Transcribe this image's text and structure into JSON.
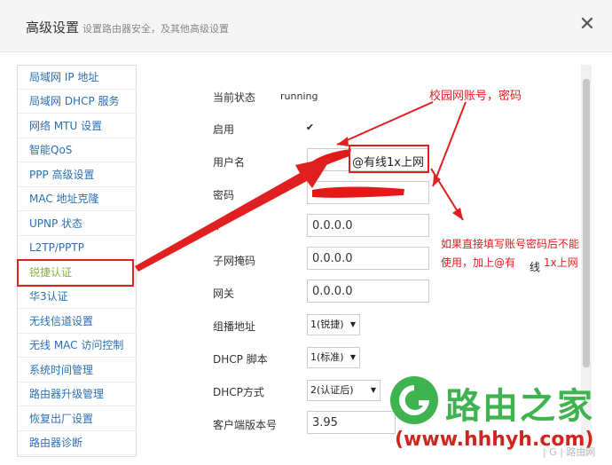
{
  "header": {
    "title": "高级设置",
    "subtitle": "设置路由器安全，及其他高级设置",
    "close_glyph": "✕"
  },
  "sidebar": {
    "items": [
      {
        "label": "局域网 IP 地址"
      },
      {
        "label": "局域网 DHCP 服务"
      },
      {
        "label": "网络 MTU 设置"
      },
      {
        "label": "智能QoS"
      },
      {
        "label": "PPP 高级设置"
      },
      {
        "label": "MAC 地址克隆"
      },
      {
        "label": "UPNP 状态"
      },
      {
        "label": "L2TP/PPTP"
      },
      {
        "label": "锐捷认证",
        "active": true
      },
      {
        "label": "华3认证"
      },
      {
        "label": "无线信道设置"
      },
      {
        "label": "无线 MAC 访问控制"
      },
      {
        "label": "系统时间管理"
      },
      {
        "label": "路由器升级管理"
      },
      {
        "label": "恢复出厂设置"
      },
      {
        "label": "路由器诊断"
      }
    ]
  },
  "form": {
    "status": {
      "label": "当前状态",
      "value": "running"
    },
    "enable": {
      "label": "启用",
      "checked": true,
      "mark": "✔"
    },
    "username": {
      "label": "用户名",
      "suffix": "@有线1x上网"
    },
    "password": {
      "label": "密码"
    },
    "ip": {
      "label": "IP",
      "value": "0.0.0.0"
    },
    "mask": {
      "label": "子网掩码",
      "value": "0.0.0.0"
    },
    "gateway": {
      "label": "网关",
      "value": "0.0.0.0"
    },
    "multicast": {
      "label": "组播地址",
      "value": "1(锐捷)"
    },
    "dhcp_script": {
      "label": "DHCP 脚本",
      "value": "1(标准)"
    },
    "dhcp_mode": {
      "label": "DHCP方式",
      "value": "2(认证后)"
    },
    "client_version": {
      "label": "客户端版本号",
      "value": "3.95"
    }
  },
  "annotations": {
    "note1": "校园网账号，密码",
    "note2_line1": "如果直接填写账号密码后不能",
    "note2_line2": "使用，加上@有",
    "note2_line2b": "线",
    "note2_line2c": "1x上网"
  },
  "branding": {
    "logo_text": "路由之家",
    "url": "(www.hhhyh.com)",
    "watermark": "| G | 路由网"
  },
  "colors": {
    "accent_link": "#2a6fb6",
    "active_item": "#8cb040",
    "annotation": "#e02020",
    "logo_green": "#3fb34f",
    "url_red": "#d0251f"
  }
}
